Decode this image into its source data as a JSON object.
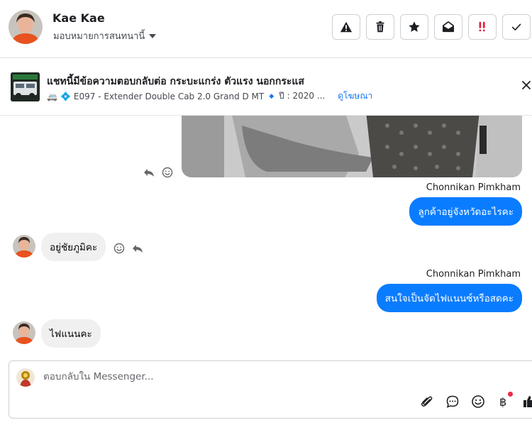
{
  "header": {
    "name": "Kae Kae",
    "assign_label": "มอบหมายการสนทนานี้",
    "actions": [
      {
        "icon": "warning-icon"
      },
      {
        "icon": "trash-icon"
      },
      {
        "icon": "star-icon"
      },
      {
        "icon": "mail-open-icon"
      },
      {
        "icon": "follow-up-icon"
      },
      {
        "icon": "check-icon"
      }
    ]
  },
  "ad": {
    "title": "แชทนี้มีข้อความตอบกลับต่อ กระบะแกร่ง ตัวแรง นอกกระแส",
    "vehicle_emoji": "🚐",
    "diamond_emoji": "💠",
    "subtitle_model": "E097 - Extender Double Cab 2.0 Grand D MT",
    "subtitle_year": "ปี : 2020 ...",
    "view_ad_label": "ดูโฆษณา"
  },
  "messages": [
    {
      "sender": "Chonnikan Pimkham",
      "text": "ลูกค้าอยู่จังหวัดอะไรคะ"
    },
    {
      "text": "อยู่ชัยภูมิคะ"
    },
    {
      "sender": "Chonnikan Pimkham",
      "text": "สนใจเป็นจัดไฟแนนซ์หรือสดคะ"
    },
    {
      "text": "ไฟแนนคะ"
    }
  ],
  "composer": {
    "placeholder": "ตอบกลับใน Messenger..."
  },
  "colors": {
    "accent": "#0a7cff",
    "link": "#1877f2",
    "alert": "#e41e3f"
  }
}
